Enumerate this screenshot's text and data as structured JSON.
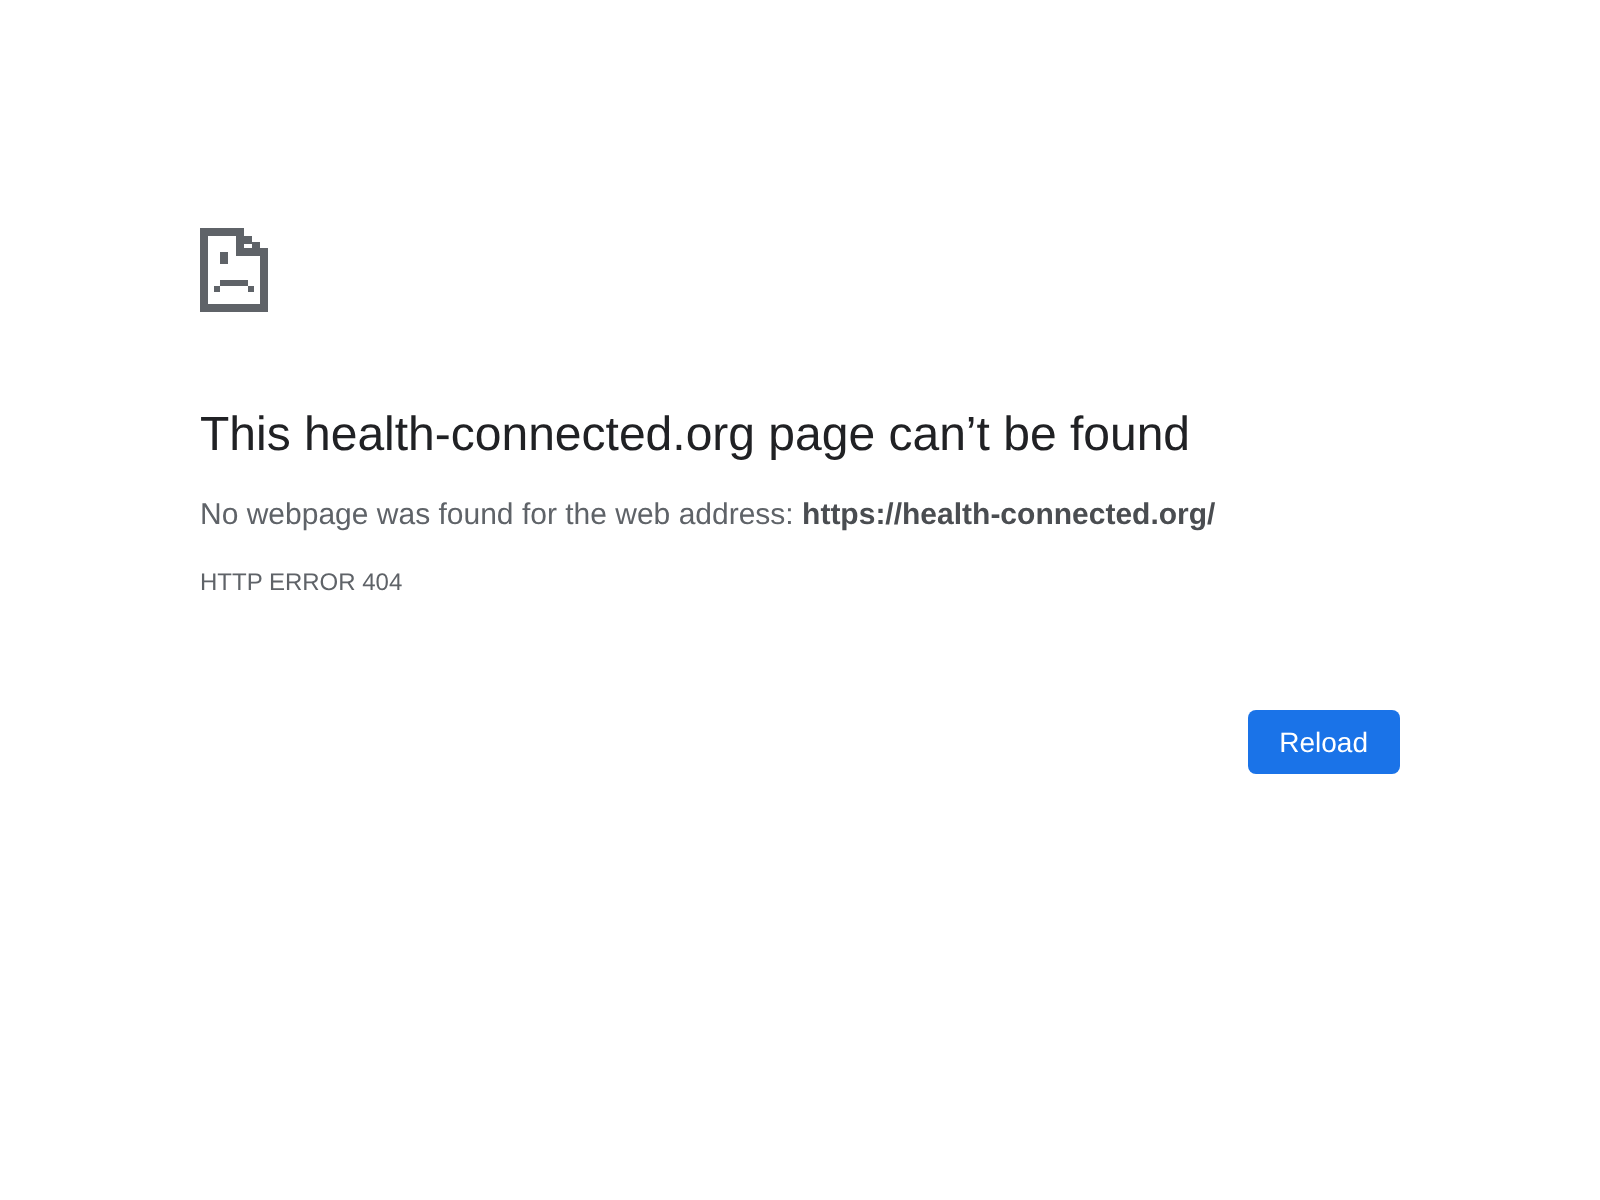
{
  "heading": "This health-connected.org page can’t be found",
  "message": "No webpage was found for the web address: **https://health-connected.org/**",
  "error_code": "HTTP ERROR 404",
  "buttons": [
    {
      "label": "Reload",
      "kind": "primary"
    }
  ]
}
